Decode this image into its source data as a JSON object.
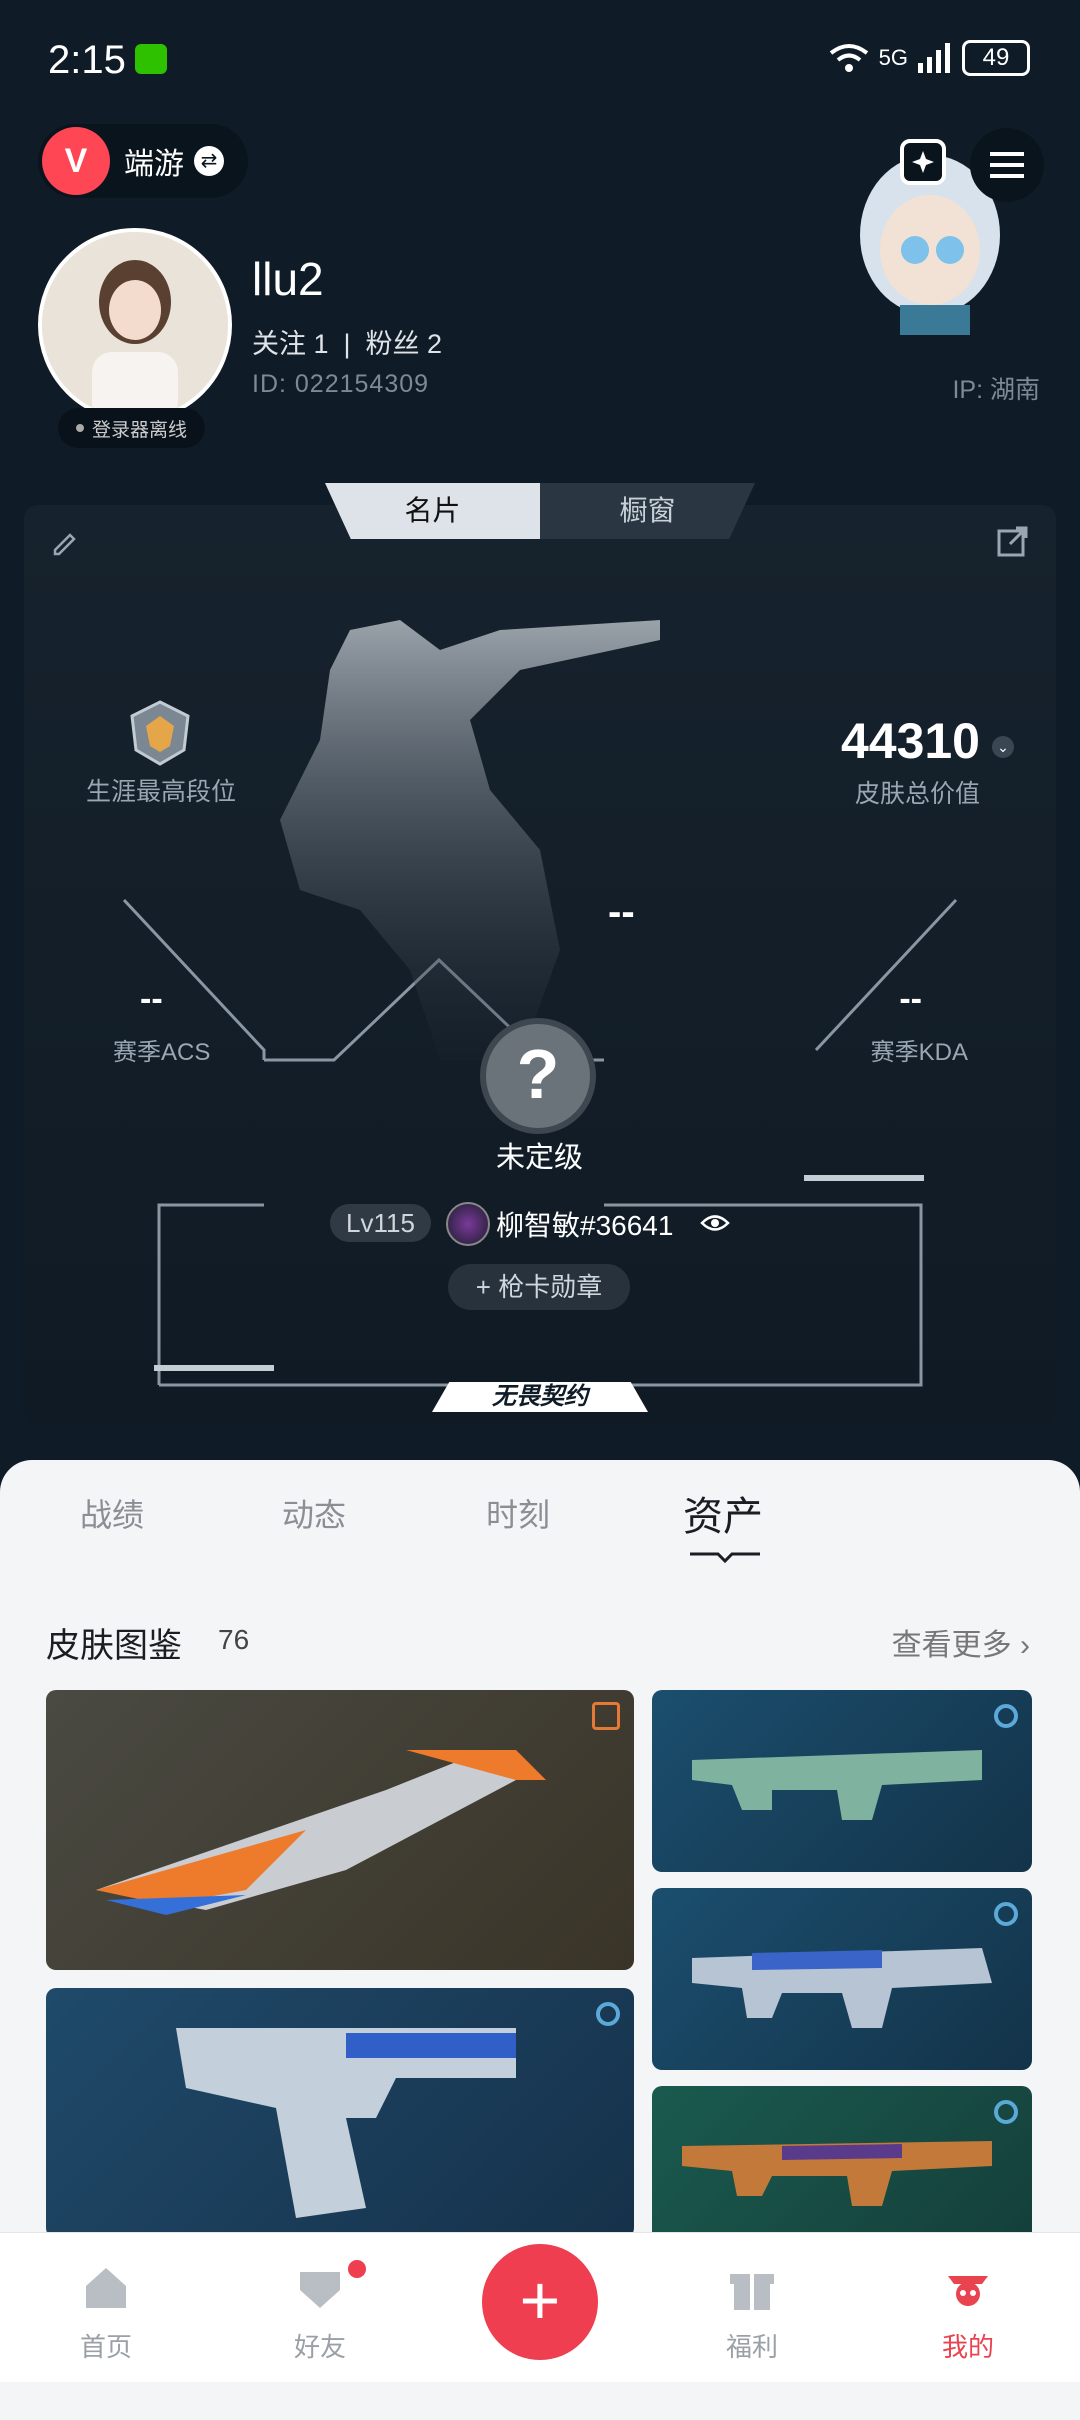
{
  "status_bar": {
    "time": "2:15",
    "network": "5G",
    "battery": "49"
  },
  "header": {
    "game_name": "端游",
    "game_logo_letter": "V"
  },
  "profile": {
    "username": "llu2",
    "follow_text": "关注 1  |  粉丝 2",
    "id_text": "ID: 022154309",
    "ip_text": "IP: 湖南",
    "login_status": "登录器离线"
  },
  "card": {
    "tabs": [
      "名片",
      "橱窗"
    ],
    "active_tab": "名片",
    "rank_label": "生涯最高段位",
    "skin_value": "44310",
    "skin_value_label": "皮肤总价值",
    "center_dash": "--",
    "acs_value": "--",
    "acs_label": "赛季ACS",
    "kda_value": "--",
    "kda_label": "赛季KDA",
    "unranked_label": "未定级",
    "level": "Lv115",
    "player_tag": "柳智敏#36641",
    "badge_button": "+ 枪卡勋章",
    "brand": "无畏契约"
  },
  "segments": {
    "items": [
      "战绩",
      "动态",
      "时刻",
      "资产"
    ],
    "active": "资产"
  },
  "skins": {
    "title": "皮肤图鉴",
    "count": "76",
    "more": "查看更多"
  },
  "nav": {
    "items": [
      "首页",
      "好友",
      "福利",
      "我的"
    ],
    "active": "我的"
  },
  "colors": {
    "accent": "#ef3e4f",
    "bg_dark": "#0f1c27"
  }
}
